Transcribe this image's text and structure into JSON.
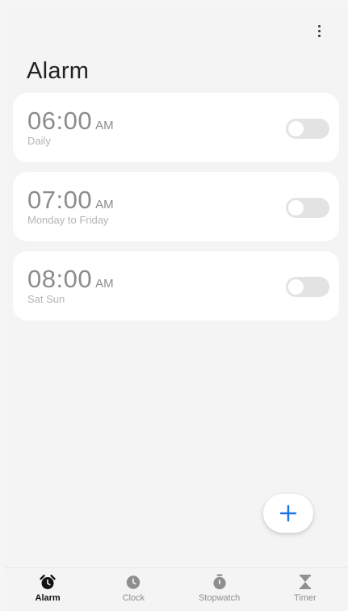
{
  "header": {
    "title": "Alarm",
    "more_icon": "more-vertical-icon"
  },
  "alarms": [
    {
      "time": "06:00",
      "ampm": "AM",
      "repeat": "Daily",
      "enabled": false
    },
    {
      "time": "07:00",
      "ampm": "AM",
      "repeat": "Monday to Friday",
      "enabled": false
    },
    {
      "time": "08:00",
      "ampm": "AM",
      "repeat": "Sat Sun",
      "enabled": false
    }
  ],
  "fab": {
    "icon": "plus-icon",
    "color": "#1a73e8"
  },
  "nav": {
    "items": [
      {
        "label": "Alarm",
        "icon": "alarm-clock-icon",
        "active": true
      },
      {
        "label": "Clock",
        "icon": "clock-icon",
        "active": false
      },
      {
        "label": "Stopwatch",
        "icon": "stopwatch-icon",
        "active": false
      },
      {
        "label": "Timer",
        "icon": "hourglass-icon",
        "active": false
      }
    ]
  },
  "colors": {
    "background": "#f4f4f4",
    "card": "#ffffff",
    "accent": "#1a73e8",
    "toggle_off": "#e3e3e3",
    "time_text": "#8c8c8c",
    "nav_active": "#111111",
    "nav_inactive": "#8e8e8e"
  }
}
